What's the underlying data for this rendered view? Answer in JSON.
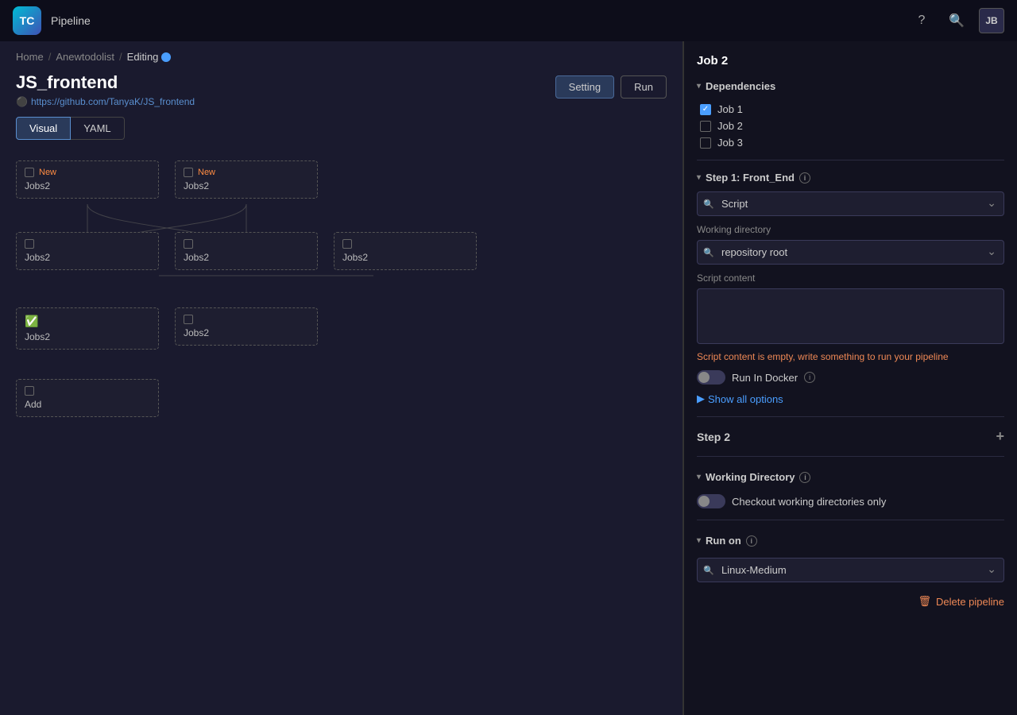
{
  "app": {
    "title": "Pipeline",
    "logo": "TC",
    "avatar": "JB"
  },
  "breadcrumb": {
    "home": "Home",
    "project": "Anewtodolist",
    "current": "Editing"
  },
  "page": {
    "title": "JS_frontend",
    "subtitle": "https://github.com/TanyaK/JS_frontend",
    "setting_button": "Setting",
    "run_button": "Run"
  },
  "tabs": [
    {
      "label": "Visual",
      "active": true
    },
    {
      "label": "YAML",
      "active": false
    }
  ],
  "pipeline": {
    "nodes": [
      {
        "id": 1,
        "badge": "New",
        "badge_color": "#ff8c42",
        "label": "Jobs2",
        "row": 1,
        "col": 1
      },
      {
        "id": 2,
        "badge": "New",
        "badge_color": "#ff8c42",
        "label": "Jobs2",
        "row": 1,
        "col": 2
      },
      {
        "id": 3,
        "badge": "",
        "label": "Jobs2",
        "row": 2,
        "col": 1
      },
      {
        "id": 4,
        "badge": "",
        "label": "Jobs2",
        "row": 2,
        "col": 2
      },
      {
        "id": 5,
        "badge": "",
        "label": "Jobs2",
        "row": 2,
        "col": 3
      },
      {
        "id": 6,
        "badge": "ok",
        "label": "Jobs2",
        "row": 3,
        "col": 1
      },
      {
        "id": 7,
        "badge": "",
        "label": "Jobs2",
        "row": 3,
        "col": 2
      },
      {
        "id": 8,
        "badge": "add",
        "label": "Add",
        "row": 4,
        "col": 1
      }
    ]
  },
  "right_panel": {
    "job_title": "Job 2",
    "dependencies_label": "Dependencies",
    "dependencies": [
      {
        "label": "Job 1",
        "checked": true
      },
      {
        "label": "Job 2",
        "checked": false
      },
      {
        "label": "Job 3",
        "checked": false
      }
    ],
    "step1_label": "Step 1: Front_End",
    "script_placeholder": "Script",
    "working_directory_label": "Working directory",
    "working_directory_value": "repository root",
    "script_content_label": "Script content",
    "script_error": "Script content is empty, write something to run your pipeline",
    "run_in_docker_label": "Run In Docker",
    "show_options_label": "Show all options",
    "step2_label": "Step 2",
    "working_directory_section": "Working Directory",
    "checkout_label": "Checkout working directories only",
    "run_on_label": "Run on",
    "run_on_value": "Linux-Medium",
    "delete_label": "Delete pipeline"
  }
}
